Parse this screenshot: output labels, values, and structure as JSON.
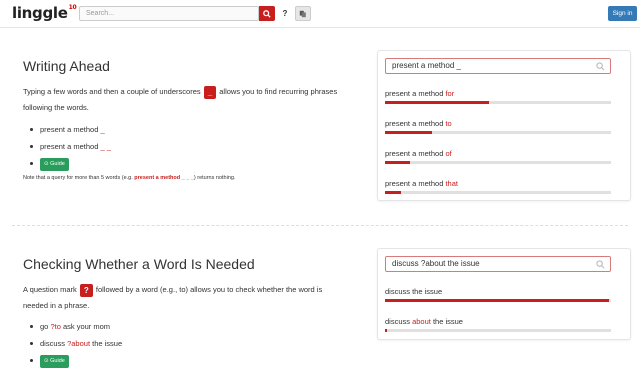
{
  "header": {
    "logo": "linggle",
    "logo_sup": "10",
    "search_placeholder": "Search...",
    "help_label": "?",
    "signin_label": "Sign in"
  },
  "section1": {
    "title": "Writing Ahead",
    "para_part1": "Typing a few words and then a couple of underscores",
    "chip": "_",
    "para_part2": "allows you to find recurring phrases",
    "para_line2": "following the words.",
    "bullet1_prefix": "present a method ",
    "bullet1_mark": "_",
    "bullet2_prefix": "present a method ",
    "bullet2_mark": "_ _",
    "guide_label": "Guide",
    "note_prefix": "Note that a query for more than 5 words (e.g. ",
    "note_example": "present a method _ _ _",
    "note_suffix": ") returns nothing.",
    "panel": {
      "query": "present a method _",
      "results": [
        {
          "prefix": "present a method ",
          "word": "for",
          "fraction": 0.46
        },
        {
          "prefix": "present a method ",
          "word": "to",
          "fraction": 0.21
        },
        {
          "prefix": "present a method ",
          "word": "of",
          "fraction": 0.11
        },
        {
          "prefix": "present a method ",
          "word": "that",
          "fraction": 0.07
        }
      ]
    }
  },
  "section2": {
    "title": "Checking Whether a Word Is Needed",
    "para_part1": "A question mark",
    "chip": "?",
    "para_part2": "followed by a word (e.g., to) allows you to check whether the word is",
    "para_line2": "needed in a phrase.",
    "bullet1_a": "go ",
    "bullet1_mark": "?to",
    "bullet1_b": " ask your mom",
    "bullet2_a": "discuss ",
    "bullet2_mark": "?about",
    "bullet2_b": " the issue",
    "guide_label": "Guide",
    "panel": {
      "query": "discuss ?about the issue",
      "results": [
        {
          "text_a": "discuss the issue",
          "word": "",
          "text_b": "",
          "fraction": 0.99
        },
        {
          "text_a": "discuss ",
          "word": "about",
          "text_b": " the issue",
          "fraction": 0.01
        }
      ]
    }
  },
  "colors": {
    "accent_red": "#c81e1e",
    "signin_blue": "#337ab7",
    "guide_green": "#2a9d5c"
  }
}
